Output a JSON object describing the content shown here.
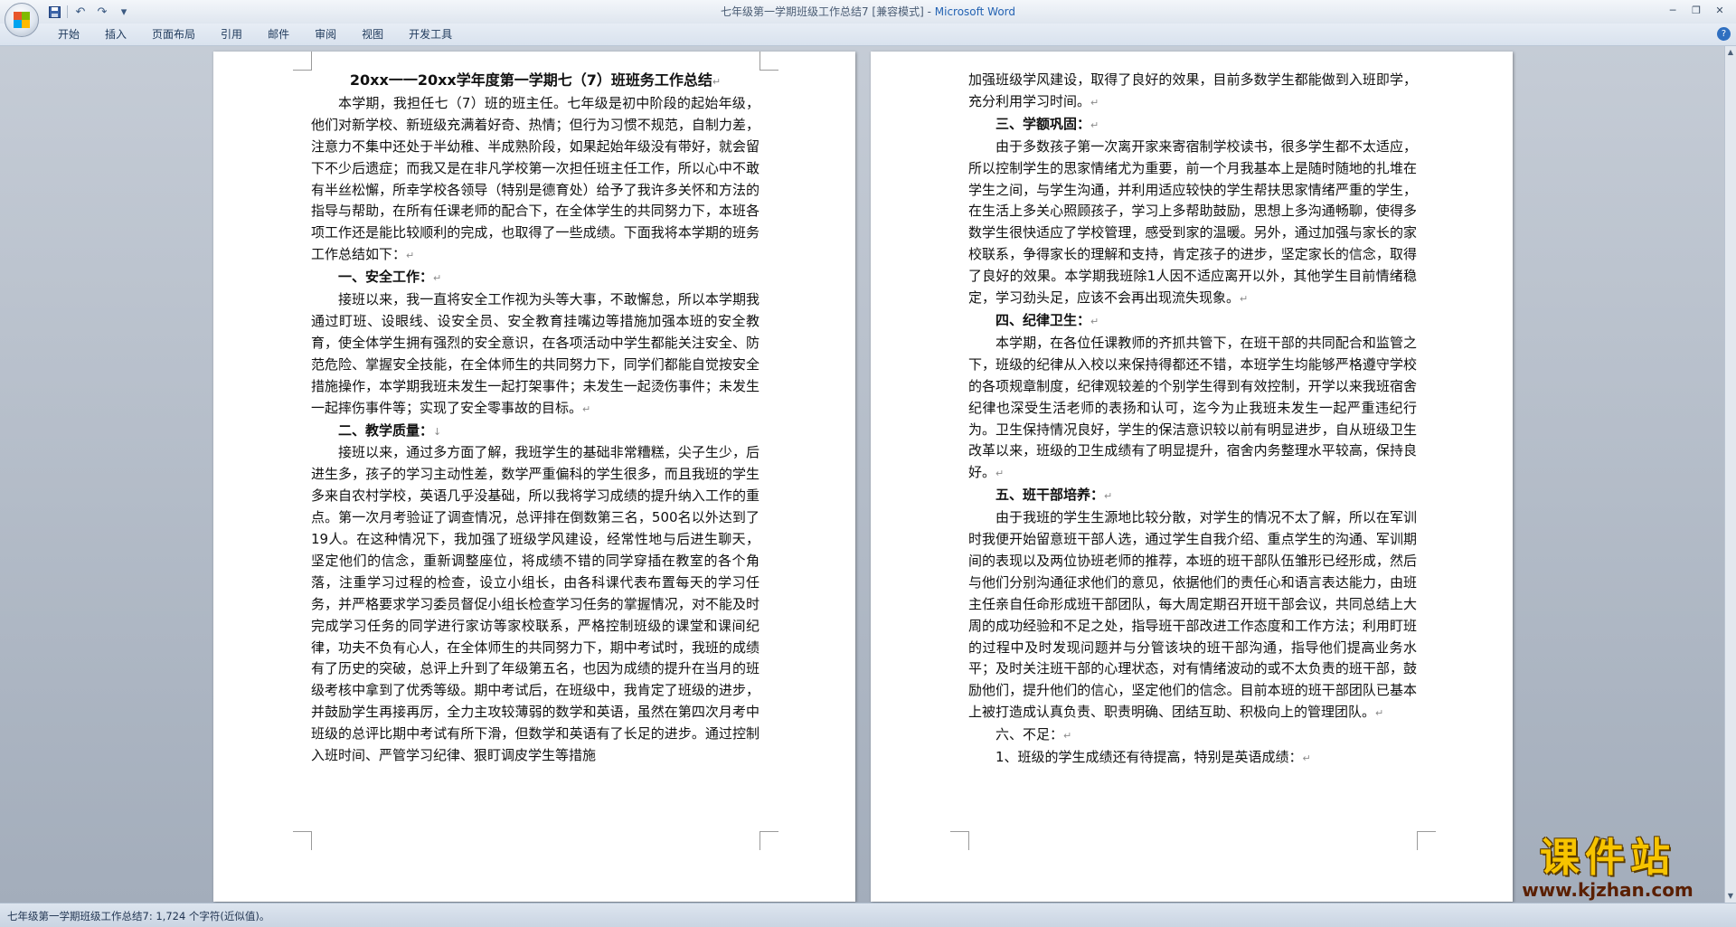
{
  "window": {
    "title_doc": "七年级第一学期班级工作总结7 [兼容模式] - ",
    "title_app": "Microsoft Word"
  },
  "quick_access": {
    "icons": [
      "save-icon",
      "undo-icon",
      "redo-icon",
      "customize-icon"
    ]
  },
  "ribbon": {
    "tabs": [
      "开始",
      "插入",
      "页面布局",
      "引用",
      "邮件",
      "审阅",
      "视图",
      "开发工具"
    ]
  },
  "document": {
    "left_page": {
      "title": "20xx一一20xx学年度第一学期七（7）班班务工作总结",
      "intro": "本学期，我担任七（7）班的班主任。七年级是初中阶段的起始年级，他们对新学校、新班级充满着好奇、热情；但行为习惯不规范，自制力差，注意力不集中还处于半幼稚、半成熟阶段，如果起始年级没有带好，就会留下不少后遗症；而我又是在非凡学校第一次担任班主任工作，所以心中不敢有半丝松懈，所幸学校各领导（特别是德育处）给予了我许多关怀和方法的指导与帮助，在所有任课老师的配合下，在全体学生的共同努力下，本班各项工作还是能比较顺利的完成，也取得了一些成绩。下面我将本学期的班务工作总结如下：",
      "h1": "一、安全工作：",
      "p1": "接班以来，我一直将安全工作视为头等大事，不敢懈怠，所以本学期我通过盯班、设眼线、设安全员、安全教育挂嘴边等措施加强本班的安全教育，使全体学生拥有强烈的安全意识，在各项活动中学生都能关注安全、防范危险、掌握安全技能，在全体师生的共同努力下，同学们都能自觉按安全措施操作，本学期我班未发生一起打架事件；未发生一起烫伤事件；未发生一起摔伤事件等；实现了安全零事故的目标。",
      "h2": "二、教学质量：",
      "p2": "接班以来，通过多方面了解，我班学生的基础非常糟糕，尖子生少，后进生多，孩子的学习主动性差，数学严重偏科的学生很多，而且我班的学生多来自农村学校，英语几乎没基础，所以我将学习成绩的提升纳入工作的重点。第一次月考验证了调查情况，总评排在倒数第三名，500名以外达到了19人。在这种情况下，我加强了班级学风建设，经常性地与后进生聊天，坚定他们的信念，重新调整座位，将成绩不错的同学穿插在教室的各个角落，注重学习过程的检查，设立小组长，由各科课代表布置每天的学习任务，并严格要求学习委员督促小组长检查学习任务的掌握情况，对不能及时完成学习任务的同学进行家访等家校联系，严格控制班级的课堂和课间纪律，功夫不负有心人，在全体师生的共同努力下，期中考试时，我班的成绩有了历史的突破，总评上升到了年级第五名，也因为成绩的提升在当月的班级考核中拿到了优秀等级。期中考试后，在班级中，我肯定了班级的进步，并鼓励学生再接再厉，全力主攻较薄弱的数学和英语，虽然在第四次月考中班级的总评比期中考试有所下滑，但数学和英语有了长足的进步。通过控制入班时间、严管学习纪律、狠盯调皮学生等措施"
    },
    "right_page": {
      "p_cont": "加强班级学风建设，取得了良好的效果，目前多数学生都能做到入班即学，充分利用学习时间。",
      "h3": "三、学额巩固：",
      "p3": "由于多数孩子第一次离开家来寄宿制学校读书，很多学生都不太适应，所以控制学生的思家情绪尤为重要，前一个月我基本上是随时随地的扎堆在学生之间，与学生沟通，并利用适应较快的学生帮扶思家情绪严重的学生，在生活上多关心照顾孩子，学习上多帮助鼓励，思想上多沟通畅聊，使得多数学生很快适应了学校管理，感受到家的温暖。另外，通过加强与家长的家校联系，争得家长的理解和支持，肯定孩子的进步，坚定家长的信念，取得了良好的效果。本学期我班除1人因不适应离开以外，其他学生目前情绪稳定，学习劲头足，应该不会再出现流失现象。",
      "h4": "四、纪律卫生：",
      "p4": "本学期，在各位任课教师的齐抓共管下，在班干部的共同配合和监管之下，班级的纪律从入校以来保持得都还不错，本班学生均能够严格遵守学校的各项规章制度，纪律观较差的个别学生得到有效控制，开学以来我班宿舍纪律也深受生活老师的表扬和认可，迄今为止我班未发生一起严重违纪行为。卫生保持情况良好，学生的保洁意识较以前有明显进步，自从班级卫生改革以来，班级的卫生成绩有了明显提升，宿舍内务整理水平较高，保持良好。",
      "h5": "五、班干部培养：",
      "p5": "由于我班的学生生源地比较分散，对学生的情况不太了解，所以在军训时我便开始留意班干部人选，通过学生自我介绍、重点学生的沟通、军训期间的表现以及两位协班老师的推荐，本班的班干部队伍雏形已经形成，然后与他们分别沟通征求他们的意见，依据他们的责任心和语言表达能力，由班主任亲自任命形成班干部团队，每大周定期召开班干部会议，共同总结上大周的成功经验和不足之处，指导班干部改进工作态度和工作方法；利用盯班的过程中及时发现问题并与分管该块的班干部沟通，指导他们提高业务水平；及时关注班干部的心理状态，对有情绪波动的或不太负责的班干部，鼓励他们，提升他们的信心，坚定他们的信念。目前本班的班干部团队已基本上被打造成认真负责、职责明确、团结互助、积极向上的管理团队。",
      "h6": "六、不足：",
      "p6": "1、班级的学生成绩还有待提高，特别是英语成绩："
    }
  },
  "status_bar": {
    "text": "七年级第一学期班级工作总结7: 1,724 个字符(近似值)。"
  },
  "watermark": {
    "title": "课件站",
    "url": "www.kjzhan.com"
  },
  "colors": {
    "accent": "#2463b3",
    "watermark": "#f7c400"
  }
}
